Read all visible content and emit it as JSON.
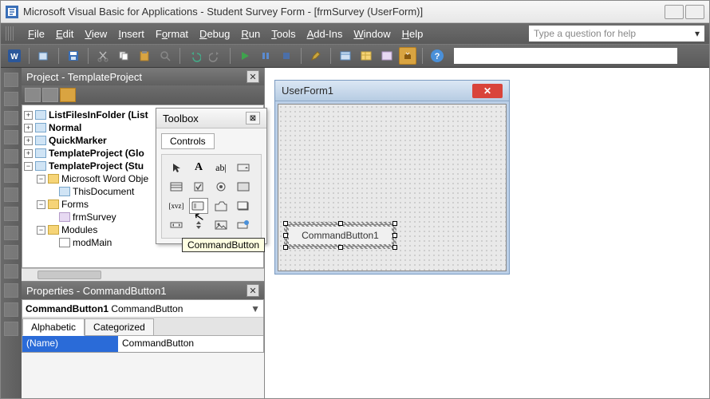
{
  "title": "Microsoft Visual Basic for Applications - Student Survey Form - [frmSurvey (UserForm)]",
  "menu": {
    "file": "File",
    "edit": "Edit",
    "view": "View",
    "insert": "Insert",
    "format": "Format",
    "debug": "Debug",
    "run": "Run",
    "tools": "Tools",
    "addins": "Add-Ins",
    "window": "Window",
    "help": "Help"
  },
  "help_placeholder": "Type a question for help",
  "project": {
    "header": "Project - TemplateProject",
    "items": {
      "n0": "ListFilesInFolder (List",
      "n1": "Normal",
      "n2": "QuickMarker",
      "n3": "TemplateProject (Glo",
      "n4": "TemplateProject (Stu",
      "mwo": "Microsoft Word Obje",
      "thisdoc": "ThisDocument",
      "forms": "Forms",
      "frm": "frmSurvey",
      "modules": "Modules",
      "modmain": "modMain"
    }
  },
  "toolbox": {
    "title": "Toolbox",
    "tab": "Controls",
    "tooltip": "CommandButton"
  },
  "form": {
    "title": "UserForm1",
    "button_caption": "CommandButton1"
  },
  "props": {
    "header": "Properties - CommandButton1",
    "object_name": "CommandButton1",
    "object_type": "CommandButton",
    "tab_alpha": "Alphabetic",
    "tab_cat": "Categorized",
    "row_name_label": "(Name)",
    "row_name_value": "CommandButton"
  }
}
